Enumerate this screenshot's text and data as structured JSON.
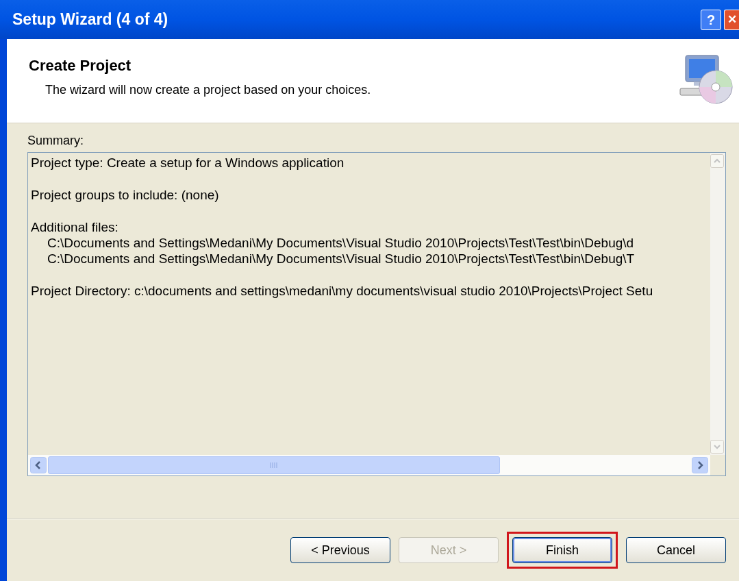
{
  "window": {
    "title": "Setup Wizard (4 of 4)",
    "help_button": "?",
    "close_button": "✕"
  },
  "header": {
    "title": "Create Project",
    "subtitle": "The wizard will now create a project based on your choices."
  },
  "summary": {
    "label": "Summary:",
    "sections": [
      {
        "heading": "Project type: Create a setup for a Windows application"
      },
      {
        "heading": "Project groups to include: (none)"
      },
      {
        "heading": "Additional files:",
        "items": [
          "C:\\Documents and Settings\\Medani\\My Documents\\Visual Studio 2010\\Projects\\Test\\Test\\bin\\Debug\\d",
          "C:\\Documents and Settings\\Medani\\My Documents\\Visual Studio 2010\\Projects\\Test\\Test\\bin\\Debug\\T"
        ]
      },
      {
        "heading": "Project Directory: c:\\documents and settings\\medani\\my documents\\visual studio 2010\\Projects\\Project Setu"
      }
    ]
  },
  "buttons": [
    {
      "label": "< Previous",
      "disabled": false,
      "default": false,
      "highlighted": false
    },
    {
      "label": "Next >",
      "disabled": true,
      "default": false,
      "highlighted": false
    },
    {
      "label": "Finish",
      "disabled": false,
      "default": true,
      "highlighted": true
    },
    {
      "label": "Cancel",
      "disabled": false,
      "default": false,
      "highlighted": false
    }
  ]
}
